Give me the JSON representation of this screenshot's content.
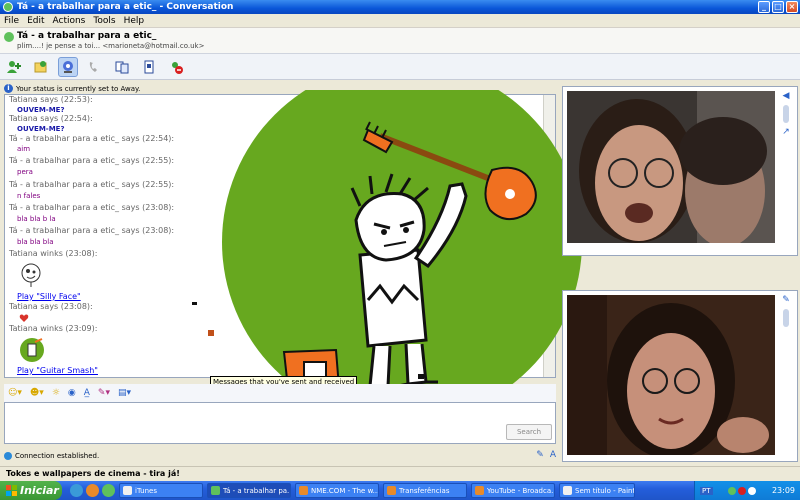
{
  "window": {
    "title": "Tá - a trabalhar para a etic_ - Conversation"
  },
  "menu": [
    "File",
    "Edit",
    "Actions",
    "Tools",
    "Help"
  ],
  "contact": {
    "name": "Tá - a trabalhar para a etic_",
    "personal_message": "plim....! je pense a toi...  <marioneta@hotmail.co.uk>"
  },
  "toolbar_icons": [
    "invite-contact-icon",
    "send-files-icon",
    "webcam-icon",
    "call-icon",
    "activities-icon",
    "games-icon",
    "block-icon"
  ],
  "status_notice": "Your status is currently set to Away.",
  "chat": [
    {
      "type": "says",
      "text": "Tatiana says (22:53):"
    },
    {
      "type": "msg_blue",
      "text": "OUVEM-ME?"
    },
    {
      "type": "says",
      "text": "Tatiana says (22:54):"
    },
    {
      "type": "msg_blue",
      "text": "OUVEM-ME?"
    },
    {
      "type": "says",
      "text": "Tá - a trabalhar para a etic_ says (22:54):"
    },
    {
      "type": "msg",
      "text": "aim"
    },
    {
      "type": "says",
      "text": "Tá - a trabalhar para a etic_ says (22:55):"
    },
    {
      "type": "msg",
      "text": "pera"
    },
    {
      "type": "says",
      "text": "Tá - a trabalhar para a etic_ says (22:55):"
    },
    {
      "type": "msg",
      "text": "n fales"
    },
    {
      "type": "says",
      "text": "Tá - a trabalhar para a etic_ says (23:08):"
    },
    {
      "type": "msg",
      "text": "bla bla b la"
    },
    {
      "type": "says",
      "text": "Tá - a trabalhar para a etic_ says (23:08):"
    },
    {
      "type": "msg",
      "text": "bla bla bla"
    },
    {
      "type": "says",
      "text": "Tatiana winks (23:08):"
    },
    {
      "type": "link",
      "text": "Play \"Silly Face\""
    },
    {
      "type": "says",
      "text": "Tatiana says (23:08):"
    },
    {
      "type": "says",
      "text": "Tatiana winks (23:09):"
    },
    {
      "type": "link",
      "text": "Play \"Guitar Smash\""
    }
  ],
  "tooltip": "Messages that you've sent and received",
  "search_button": "Search",
  "connection_status": "Connection established.",
  "ad_text": "Tokes e wallpapers de cinema - tira já!",
  "taskbar": {
    "start_label": "Iniciar",
    "tasks": [
      {
        "label": "iTunes",
        "active": false
      },
      {
        "label": "Tá - a trabalhar pa...",
        "active": true
      },
      {
        "label": "NME.COM - The w...",
        "active": false
      },
      {
        "label": "Transferências",
        "active": false
      },
      {
        "label": "YouTube - Broadca...",
        "active": false
      },
      {
        "label": "Sem título - Paint",
        "active": false
      },
      {
        "label": "Sem título - Paint",
        "active": false
      }
    ],
    "language": "PT",
    "clock": "23:09"
  },
  "colors": {
    "title_blue": "#0a56d8",
    "art_green": "#67a81f",
    "guitar_orange": "#f07020",
    "link_blue": "#0000ee",
    "msg_purple": "#800080"
  }
}
